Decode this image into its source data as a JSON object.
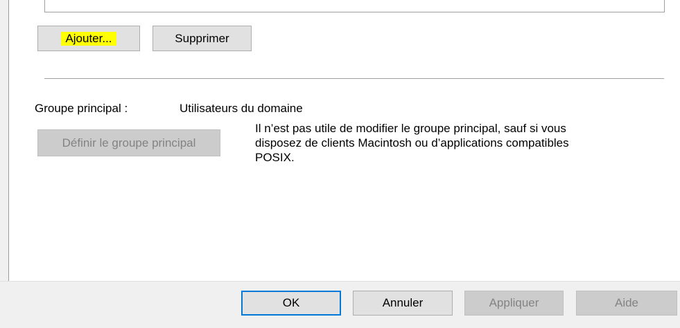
{
  "members": {
    "add_label": "Ajouter...",
    "remove_label": "Supprimer"
  },
  "primary_group": {
    "label": "Groupe principal :",
    "value": "Utilisateurs du domaine",
    "set_button_label": "Définir le groupe principal",
    "info_lines": [
      "Il n’est pas utile de modifier le groupe principal, sauf si vous",
      "disposez de clients Macintosh ou d’applications compatibles",
      "POSIX."
    ]
  },
  "footer": {
    "ok_label": "OK",
    "cancel_label": "Annuler",
    "apply_label": "Appliquer",
    "help_label": "Aide"
  },
  "colors": {
    "highlight": "#ffff00",
    "default_button_border": "#0078d7",
    "disabled_text": "#838383"
  }
}
